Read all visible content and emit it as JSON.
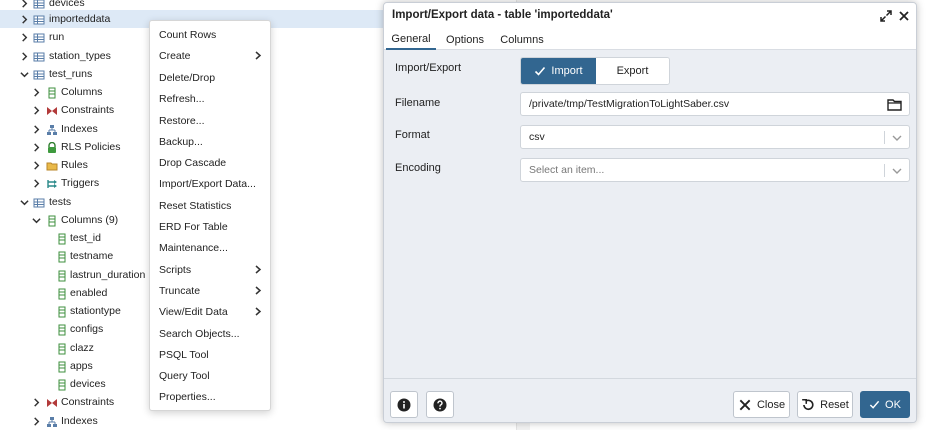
{
  "tree": {
    "items": [
      {
        "label": "devices"
      },
      {
        "label": "importeddata"
      },
      {
        "label": "run"
      },
      {
        "label": "station_types"
      },
      {
        "label": "test_runs"
      },
      {
        "label": "Columns"
      },
      {
        "label": "Constraints"
      },
      {
        "label": "Indexes"
      },
      {
        "label": "RLS Policies"
      },
      {
        "label": "Rules"
      },
      {
        "label": "Triggers"
      },
      {
        "label": "tests"
      },
      {
        "label": "Columns (9)"
      },
      {
        "label": "test_id"
      },
      {
        "label": "testname"
      },
      {
        "label": "lastrun_duration"
      },
      {
        "label": "enabled"
      },
      {
        "label": "stationtype"
      },
      {
        "label": "configs"
      },
      {
        "label": "clazz"
      },
      {
        "label": "apps"
      },
      {
        "label": "devices"
      },
      {
        "label": "Constraints"
      },
      {
        "label": "Indexes"
      }
    ]
  },
  "context_menu": {
    "items": [
      {
        "label": "Count Rows"
      },
      {
        "label": "Create"
      },
      {
        "label": "Delete/Drop"
      },
      {
        "label": "Refresh..."
      },
      {
        "label": "Restore..."
      },
      {
        "label": "Backup..."
      },
      {
        "label": "Drop Cascade"
      },
      {
        "label": "Import/Export Data..."
      },
      {
        "label": "Reset Statistics"
      },
      {
        "label": "ERD For Table"
      },
      {
        "label": "Maintenance..."
      },
      {
        "label": "Scripts"
      },
      {
        "label": "Truncate"
      },
      {
        "label": "View/Edit Data"
      },
      {
        "label": "Search Objects..."
      },
      {
        "label": "PSQL Tool"
      },
      {
        "label": "Query Tool"
      },
      {
        "label": "Properties..."
      }
    ]
  },
  "dialog": {
    "title": "Import/Export data - table 'importeddata'",
    "tabs": [
      {
        "label": "General"
      },
      {
        "label": "Options"
      },
      {
        "label": "Columns"
      }
    ],
    "import_export_label": "Import/Export",
    "import_label": "Import",
    "export_label": "Export",
    "filename_label": "Filename",
    "filename_value": "/private/tmp/TestMigrationToLightSaber.csv",
    "format_label": "Format",
    "format_value": "csv",
    "encoding_label": "Encoding",
    "encoding_placeholder": "Select an item...",
    "close_label": "Close",
    "reset_label": "Reset",
    "ok_label": "OK"
  },
  "colors": {
    "accent": "#326690",
    "selection": "#dde9f6",
    "dialog_bg": "#ebeef3"
  },
  "icons": {
    "tree_table": "table-icon",
    "tree_columns": "columns-icon",
    "tree_constraints": "constraints-icon",
    "tree_indexes": "indexes-icon",
    "tree_rls": "rls-policies-icon",
    "tree_rules": "rules-icon",
    "tree_triggers": "triggers-icon",
    "tree_column": "column-icon"
  }
}
